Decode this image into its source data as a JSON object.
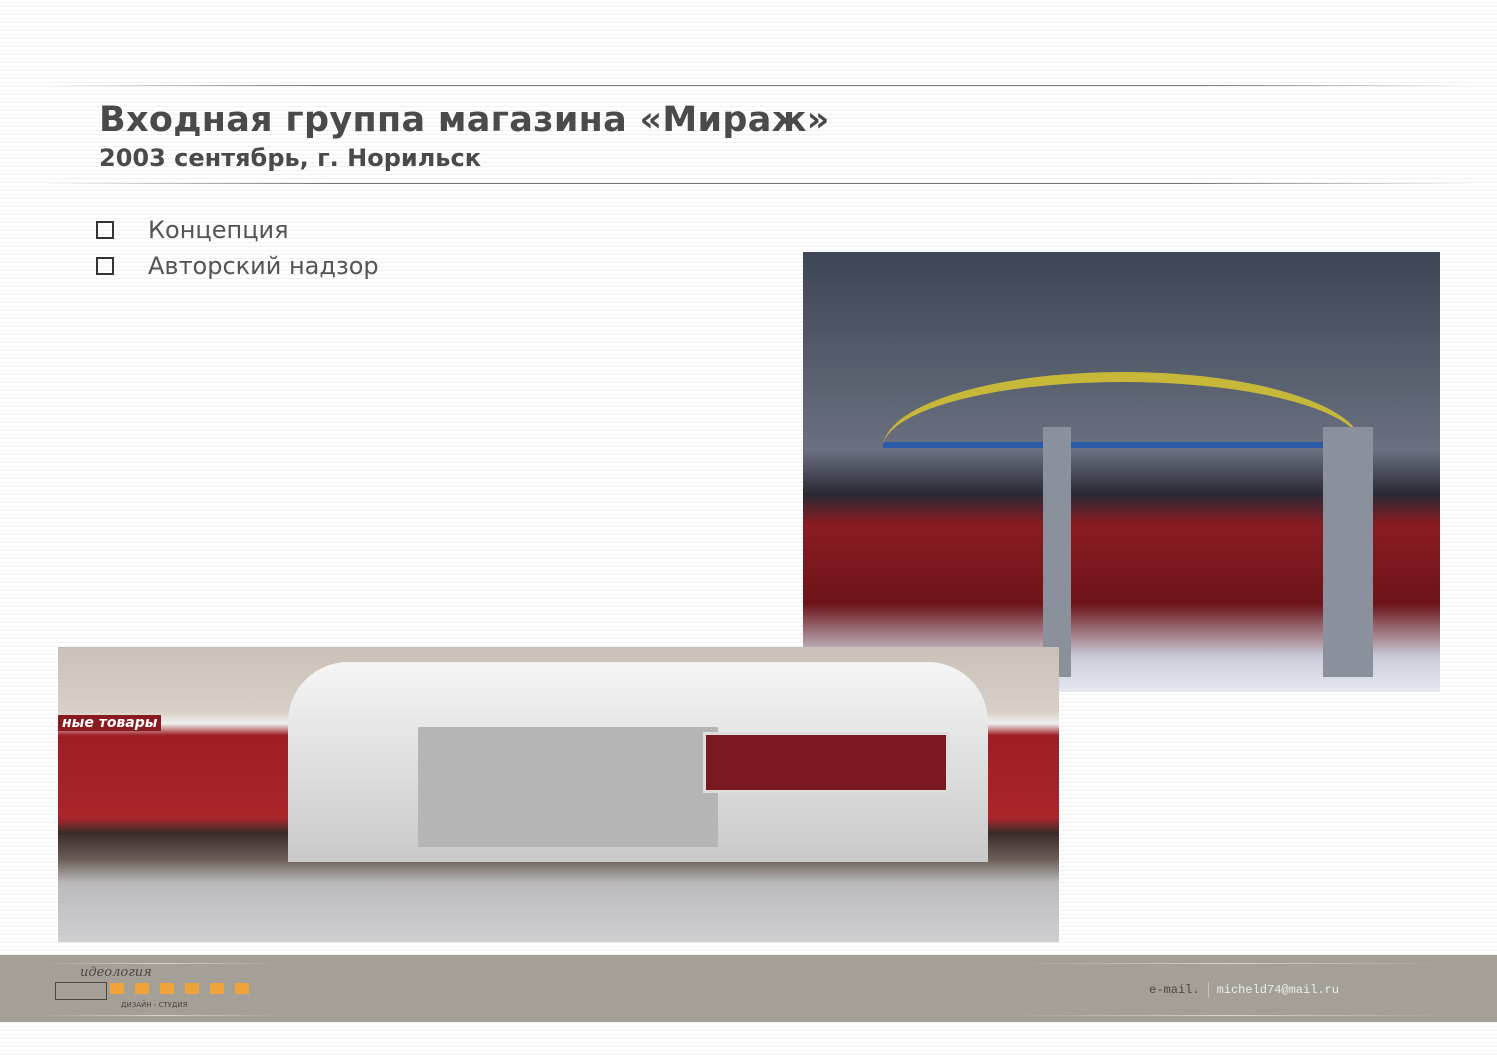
{
  "header": {
    "title": "Входная группа магазина «Мираж»",
    "subtitle": "2003 сентябрь, г. Норильск"
  },
  "bullets": [
    {
      "label": "Концепция",
      "icon": "checkbox-empty-icon"
    },
    {
      "label": "Авторский надзор",
      "icon": "checkbox-empty-icon"
    }
  ],
  "images": {
    "photo": "Photograph of store entrance canopy at dusk in snow",
    "render": "3D render of store entrance group",
    "render_sign": "ные товары"
  },
  "footer": {
    "logo": {
      "script": "идеология",
      "studio": "ДИЗАЙН - СТУДИЯ"
    },
    "email_label": "e-mail.",
    "email_value": "micheld74@mail.ru",
    "background": "#a49f97",
    "accent": "#f0a33a"
  }
}
